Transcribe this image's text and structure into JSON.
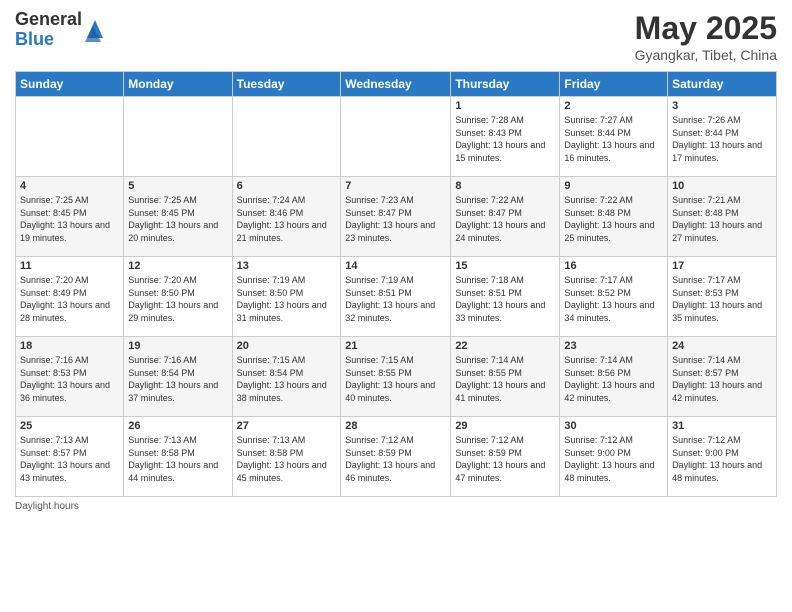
{
  "logo": {
    "general": "General",
    "blue": "Blue"
  },
  "header": {
    "month": "May 2025",
    "location": "Gyangkar, Tibet, China"
  },
  "weekdays": [
    "Sunday",
    "Monday",
    "Tuesday",
    "Wednesday",
    "Thursday",
    "Friday",
    "Saturday"
  ],
  "weeks": [
    [
      {
        "day": "",
        "info": ""
      },
      {
        "day": "",
        "info": ""
      },
      {
        "day": "",
        "info": ""
      },
      {
        "day": "",
        "info": ""
      },
      {
        "day": "1",
        "info": "Sunrise: 7:28 AM\nSunset: 8:43 PM\nDaylight: 13 hours and 15 minutes."
      },
      {
        "day": "2",
        "info": "Sunrise: 7:27 AM\nSunset: 8:44 PM\nDaylight: 13 hours and 16 minutes."
      },
      {
        "day": "3",
        "info": "Sunrise: 7:26 AM\nSunset: 8:44 PM\nDaylight: 13 hours and 17 minutes."
      }
    ],
    [
      {
        "day": "4",
        "info": "Sunrise: 7:25 AM\nSunset: 8:45 PM\nDaylight: 13 hours and 19 minutes."
      },
      {
        "day": "5",
        "info": "Sunrise: 7:25 AM\nSunset: 8:45 PM\nDaylight: 13 hours and 20 minutes."
      },
      {
        "day": "6",
        "info": "Sunrise: 7:24 AM\nSunset: 8:46 PM\nDaylight: 13 hours and 21 minutes."
      },
      {
        "day": "7",
        "info": "Sunrise: 7:23 AM\nSunset: 8:47 PM\nDaylight: 13 hours and 23 minutes."
      },
      {
        "day": "8",
        "info": "Sunrise: 7:22 AM\nSunset: 8:47 PM\nDaylight: 13 hours and 24 minutes."
      },
      {
        "day": "9",
        "info": "Sunrise: 7:22 AM\nSunset: 8:48 PM\nDaylight: 13 hours and 25 minutes."
      },
      {
        "day": "10",
        "info": "Sunrise: 7:21 AM\nSunset: 8:48 PM\nDaylight: 13 hours and 27 minutes."
      }
    ],
    [
      {
        "day": "11",
        "info": "Sunrise: 7:20 AM\nSunset: 8:49 PM\nDaylight: 13 hours and 28 minutes."
      },
      {
        "day": "12",
        "info": "Sunrise: 7:20 AM\nSunset: 8:50 PM\nDaylight: 13 hours and 29 minutes."
      },
      {
        "day": "13",
        "info": "Sunrise: 7:19 AM\nSunset: 8:50 PM\nDaylight: 13 hours and 31 minutes."
      },
      {
        "day": "14",
        "info": "Sunrise: 7:19 AM\nSunset: 8:51 PM\nDaylight: 13 hours and 32 minutes."
      },
      {
        "day": "15",
        "info": "Sunrise: 7:18 AM\nSunset: 8:51 PM\nDaylight: 13 hours and 33 minutes."
      },
      {
        "day": "16",
        "info": "Sunrise: 7:17 AM\nSunset: 8:52 PM\nDaylight: 13 hours and 34 minutes."
      },
      {
        "day": "17",
        "info": "Sunrise: 7:17 AM\nSunset: 8:53 PM\nDaylight: 13 hours and 35 minutes."
      }
    ],
    [
      {
        "day": "18",
        "info": "Sunrise: 7:16 AM\nSunset: 8:53 PM\nDaylight: 13 hours and 36 minutes."
      },
      {
        "day": "19",
        "info": "Sunrise: 7:16 AM\nSunset: 8:54 PM\nDaylight: 13 hours and 37 minutes."
      },
      {
        "day": "20",
        "info": "Sunrise: 7:15 AM\nSunset: 8:54 PM\nDaylight: 13 hours and 38 minutes."
      },
      {
        "day": "21",
        "info": "Sunrise: 7:15 AM\nSunset: 8:55 PM\nDaylight: 13 hours and 40 minutes."
      },
      {
        "day": "22",
        "info": "Sunrise: 7:14 AM\nSunset: 8:55 PM\nDaylight: 13 hours and 41 minutes."
      },
      {
        "day": "23",
        "info": "Sunrise: 7:14 AM\nSunset: 8:56 PM\nDaylight: 13 hours and 42 minutes."
      },
      {
        "day": "24",
        "info": "Sunrise: 7:14 AM\nSunset: 8:57 PM\nDaylight: 13 hours and 42 minutes."
      }
    ],
    [
      {
        "day": "25",
        "info": "Sunrise: 7:13 AM\nSunset: 8:57 PM\nDaylight: 13 hours and 43 minutes."
      },
      {
        "day": "26",
        "info": "Sunrise: 7:13 AM\nSunset: 8:58 PM\nDaylight: 13 hours and 44 minutes."
      },
      {
        "day": "27",
        "info": "Sunrise: 7:13 AM\nSunset: 8:58 PM\nDaylight: 13 hours and 45 minutes."
      },
      {
        "day": "28",
        "info": "Sunrise: 7:12 AM\nSunset: 8:59 PM\nDaylight: 13 hours and 46 minutes."
      },
      {
        "day": "29",
        "info": "Sunrise: 7:12 AM\nSunset: 8:59 PM\nDaylight: 13 hours and 47 minutes."
      },
      {
        "day": "30",
        "info": "Sunrise: 7:12 AM\nSunset: 9:00 PM\nDaylight: 13 hours and 48 minutes."
      },
      {
        "day": "31",
        "info": "Sunrise: 7:12 AM\nSunset: 9:00 PM\nDaylight: 13 hours and 48 minutes."
      }
    ]
  ],
  "footer": {
    "daylight_label": "Daylight hours"
  }
}
